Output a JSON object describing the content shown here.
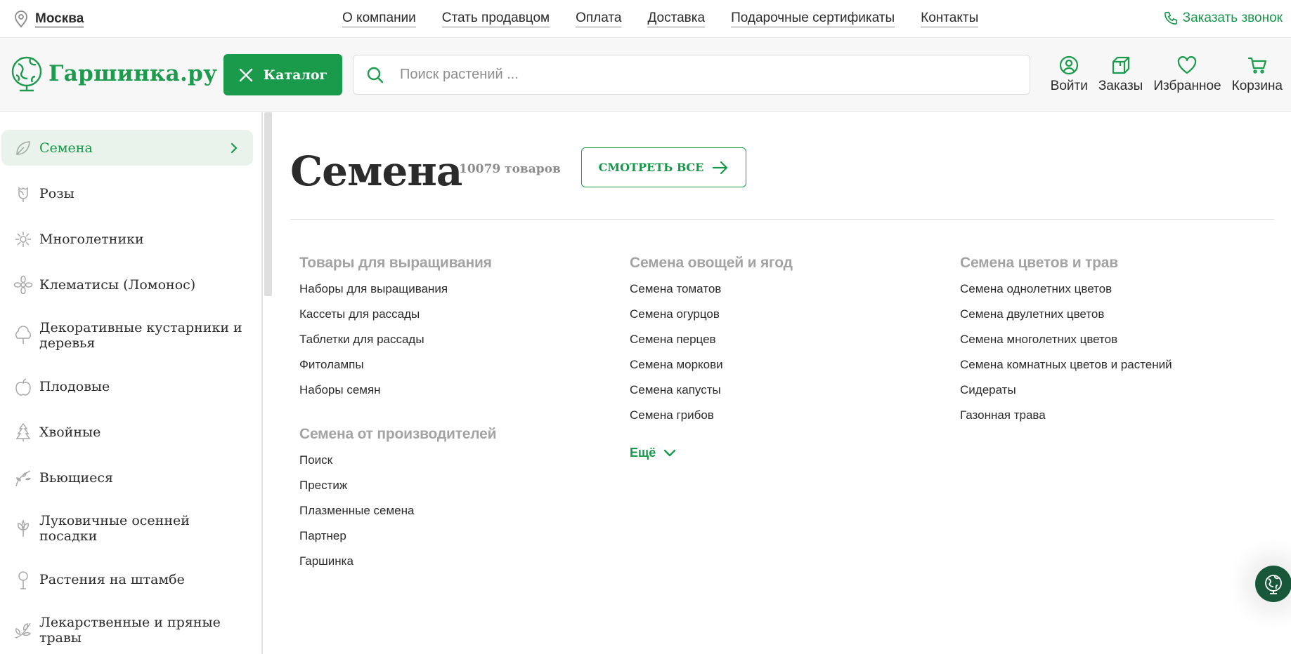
{
  "topbar": {
    "city": "Москва",
    "nav": [
      "О компании",
      "Стать продавцом",
      "Оплата",
      "Доставка",
      "Подарочные сертификаты",
      "Контакты"
    ],
    "callback": "Заказать звонок"
  },
  "header": {
    "logo_text": "Гаршинка.ру",
    "catalog_label": "Каталог",
    "search_placeholder": "Поиск растений ...",
    "actions": {
      "login": "Войти",
      "orders": "Заказы",
      "favorites": "Избранное",
      "cart": "Корзина"
    }
  },
  "sidebar": {
    "items": [
      {
        "label": "Семена",
        "icon": "seed-icon",
        "active": true
      },
      {
        "label": "Розы",
        "icon": "rose-icon"
      },
      {
        "label": "Многолетники",
        "icon": "perennial-flower-icon"
      },
      {
        "label": "Клематисы (Ломонос)",
        "icon": "clematis-icon"
      },
      {
        "label": "Декоративные кустарники и деревья",
        "icon": "shrub-icon"
      },
      {
        "label": "Плодовые",
        "icon": "apple-icon"
      },
      {
        "label": "Хвойные",
        "icon": "conifer-icon"
      },
      {
        "label": "Вьющиеся",
        "icon": "vine-icon"
      },
      {
        "label": "Луковичные осенней посадки",
        "icon": "bulb-icon"
      },
      {
        "label": "Растения на штамбе",
        "icon": "standard-tree-icon"
      },
      {
        "label": "Лекарственные и пряные травы",
        "icon": "herb-icon"
      }
    ]
  },
  "main": {
    "title": "Семена",
    "count": "10079 товаров",
    "see_all": "СМОТРЕТЬ ВСЕ",
    "columns": [
      {
        "blocks": [
          {
            "heading": "Товары для выращивания",
            "links": [
              "Наборы для выращивания",
              "Кассеты для рассады",
              "Таблетки для рассады",
              "Фитолампы",
              "Наборы семян"
            ]
          },
          {
            "heading": "Семена от производителей",
            "links": [
              "Поиск",
              "Престиж",
              "Плазменные семена",
              "Партнер",
              "Гаршинка"
            ]
          }
        ]
      },
      {
        "blocks": [
          {
            "heading": "Семена овощей и ягод",
            "links": [
              "Семена томатов",
              "Семена огурцов",
              "Семена перцев",
              "Семена моркови",
              "Семена капусты",
              "Семена грибов"
            ]
          }
        ],
        "more": "Ещё"
      },
      {
        "blocks": [
          {
            "heading": "Семена цветов и трав",
            "links": [
              "Семена однолетних цветов",
              "Семена двулетних цветов",
              "Семена многолетних цветов",
              "Семена комнатных цветов и растений",
              "Сидераты",
              "Газонная трава"
            ]
          }
        ]
      }
    ]
  },
  "colors": {
    "brand_green": "#1a9a4b",
    "active_bg": "#e9f3ec",
    "heading_gray": "#a3a3a3",
    "chat_bg": "#18573a"
  }
}
